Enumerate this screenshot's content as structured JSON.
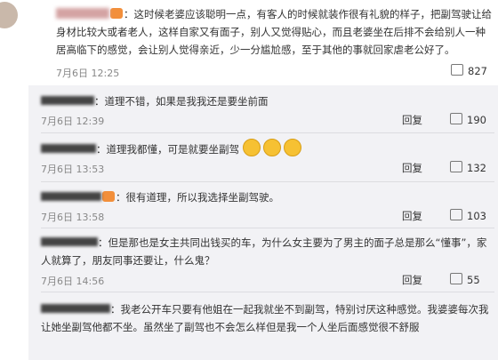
{
  "main_comment": {
    "username": "我…",
    "text": "：这时候老婆应该聪明一点，有客人的时候就装作很有礼貌的样子，把副驾驶让给身材比较大或者老人，这样自家又有面子，别人又觉得贴心，而且老婆坐在后排不会给别人一种居高临下的感觉，会让别人觉得亲近，少一分尴尬感，至于其他的事就回家虐老公好了。",
    "time": "7月6日 12:25",
    "likes": "827"
  },
  "replies": [
    {
      "text": "：道理不错，如果是我我还是要坐前面",
      "time": "7月6日 12:39",
      "reply": "回复",
      "likes": "190"
    },
    {
      "text": "：道理我都懂，可是就要坐副驾",
      "time": "7月6日 13:53",
      "reply": "回复",
      "likes": "132"
    },
    {
      "text": "：很有道理，所以我选择坐副驾驶。",
      "time": "7月6日 13:58",
      "reply": "回复",
      "likes": "103"
    },
    {
      "text": "：但是那也是女主共同出钱买的车，为什么女主要为了男主的面子总是那么“懂事”，家人就算了，朋友同事还要让，什么鬼？",
      "time": "7月6日 14:56",
      "reply": "回复",
      "likes": "55"
    },
    {
      "text": "：我老公开车只要有他姐在一起我就坐不到副驾，特别讨厌这种感觉。我婆婆每次我让她坐副驾他都不坐。虽然坐了副驾也不会怎么样但是我一个人坐后面感觉很不舒服",
      "time": "",
      "reply": "",
      "likes": ""
    }
  ]
}
